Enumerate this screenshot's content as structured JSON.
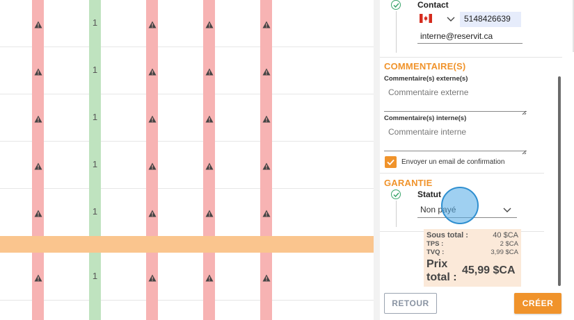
{
  "grid": {
    "rows": [
      {
        "cells": [
          "warning",
          "1",
          "warning",
          "warning",
          "warning"
        ]
      },
      {
        "cells": [
          "warning",
          "1",
          "warning",
          "warning",
          "warning"
        ]
      },
      {
        "cells": [
          "warning",
          "1",
          "warning",
          "warning",
          "warning"
        ]
      },
      {
        "cells": [
          "warning",
          "1",
          "warning",
          "warning",
          "warning"
        ]
      },
      {
        "cells": [
          "warning",
          "1",
          "warning",
          "warning",
          "warning"
        ]
      },
      {
        "cells": [
          "warning",
          "1",
          "warning",
          "warning",
          "warning"
        ]
      }
    ],
    "colors": {
      "red": "#f7b3b3",
      "green": "#bfe3bf",
      "highlight": "#fac58e"
    }
  },
  "contact": {
    "title": "Contact",
    "country_flag": "canada-flag-icon",
    "phone": "5148426639",
    "email": "interne@reservit.ca"
  },
  "comments": {
    "section_title": "COMMENTAIRE(S)",
    "external_label": "Commentaire(s) externe(s)",
    "external_placeholder": "Commentaire externe",
    "internal_label": "Commentaire(s) interne(s)",
    "internal_placeholder": "Commentaire interne",
    "email_confirmation_label": "Envoyer un email de confirmation",
    "email_confirmation_checked": true
  },
  "guarantee": {
    "section_title": "GARANTIE",
    "status_label": "Statut",
    "status_value": "Non payé"
  },
  "totals": {
    "subtotal_label": "Sous total :",
    "subtotal_value": "40 $CA",
    "tps_label": "TPS :",
    "tps_value": "2 $CA",
    "tvq_label": "TVQ :",
    "tvq_value": "3,99 $CA",
    "total_label_line1": "Prix",
    "total_label_line2": "total :",
    "total_value": "45,99 $CA"
  },
  "actions": {
    "back_label": "RETOUR",
    "create_label": "CRÉER"
  },
  "accent_color": "#f0932b"
}
